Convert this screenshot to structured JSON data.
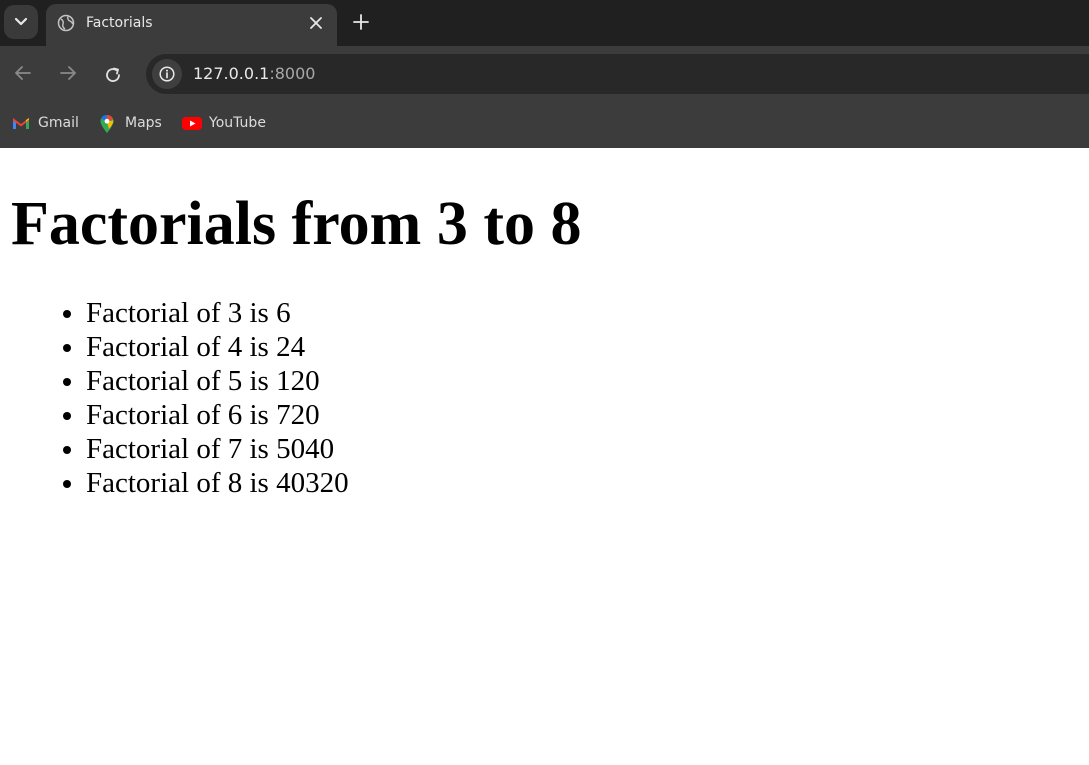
{
  "browser": {
    "tab": {
      "title": "Factorials"
    },
    "address_bar": {
      "host": "127.0.0.1",
      "port": ":8000"
    },
    "bookmarks": [
      {
        "label": "Gmail",
        "icon": "gmail-icon"
      },
      {
        "label": "Maps",
        "icon": "maps-icon"
      },
      {
        "label": "YouTube",
        "icon": "youtube-icon"
      }
    ]
  },
  "page": {
    "heading": "Factorials from 3 to 8",
    "items": [
      "Factorial of 3 is 6",
      "Factorial of 4 is 24",
      "Factorial of 5 is 120",
      "Factorial of 6 is 720",
      "Factorial of 7 is 5040",
      "Factorial of 8 is 40320"
    ]
  },
  "colors": {
    "tabstrip": "#202020",
    "toolbar": "#3c3c3c",
    "omnibox": "#282828",
    "page_background": "#ffffff"
  }
}
